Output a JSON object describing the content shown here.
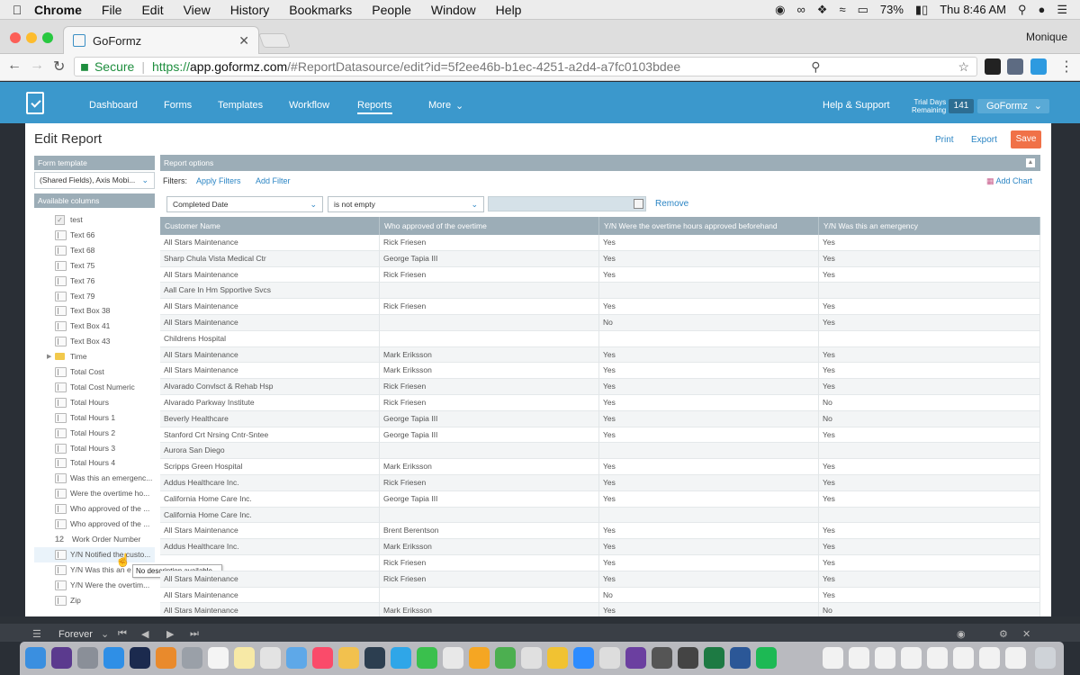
{
  "menubar": {
    "items": [
      "Chrome",
      "File",
      "Edit",
      "View",
      "History",
      "Bookmarks",
      "People",
      "Window",
      "Help"
    ],
    "battery": "73%",
    "clock": "Thu 8:46 AM"
  },
  "browser": {
    "tab_title": "GoFormz",
    "profile": "Monique",
    "secure_label": "Secure",
    "url_proto": "https://",
    "url_host": "app.goformz.com",
    "url_path": "/#ReportDatasource/edit?id=5f2ee46b-b1ec-4251-a2d4-a7fc0103bdee"
  },
  "app": {
    "nav": [
      "Dashboard",
      "Forms",
      "Templates",
      "Workflow",
      "Reports",
      "More"
    ],
    "help": "Help & Support",
    "trial_l1": "Trial Days",
    "trial_l2": "Remaining",
    "trial_count": "141",
    "account": "GoFormz"
  },
  "page": {
    "title": "Edit Report",
    "print": "Print",
    "export": "Export",
    "save": "Save"
  },
  "left": {
    "form_template_label": "Form template",
    "form_template_value": "(Shared Fields), Axis Mobi...",
    "available_columns_label": "Available columns",
    "columns": [
      {
        "label": "test",
        "icon": "check"
      },
      {
        "label": "Text 66",
        "icon": "text"
      },
      {
        "label": "Text 68",
        "icon": "text"
      },
      {
        "label": "Text 75",
        "icon": "text"
      },
      {
        "label": "Text 76",
        "icon": "text"
      },
      {
        "label": "Text 79",
        "icon": "text"
      },
      {
        "label": "Text Box 38",
        "icon": "text"
      },
      {
        "label": "Text Box 41",
        "icon": "text"
      },
      {
        "label": "Text Box 43",
        "icon": "text"
      },
      {
        "label": "Time",
        "icon": "folder"
      },
      {
        "label": "Total Cost",
        "icon": "text"
      },
      {
        "label": "Total Cost Numeric",
        "icon": "text"
      },
      {
        "label": "Total Hours",
        "icon": "text"
      },
      {
        "label": "Total Hours 1",
        "icon": "text"
      },
      {
        "label": "Total Hours 2",
        "icon": "text"
      },
      {
        "label": "Total Hours 3",
        "icon": "text"
      },
      {
        "label": "Total Hours 4",
        "icon": "text"
      },
      {
        "label": "Was this an emergenc...",
        "icon": "text"
      },
      {
        "label": "Were the overtime ho...",
        "icon": "text"
      },
      {
        "label": "Who approved of the ...",
        "icon": "text"
      },
      {
        "label": "Who approved of the ...",
        "icon": "text"
      },
      {
        "label": "Work Order Number",
        "icon": "number"
      },
      {
        "label": "Y/N Notified the custo...",
        "icon": "text"
      },
      {
        "label": "Y/N Was this an e",
        "icon": "text"
      },
      {
        "label": "Y/N Were the overtim...",
        "icon": "text"
      },
      {
        "label": "Zip",
        "icon": "text"
      }
    ],
    "tooltip": "No description available.",
    "number_glyph": "12"
  },
  "report": {
    "options_label": "Report options",
    "filters_label": "Filters:",
    "apply_filters": "Apply Filters",
    "add_filter": "Add Filter",
    "add_chart": "Add Chart",
    "filter_field": "Completed Date",
    "filter_op": "is not empty",
    "remove": "Remove",
    "columns": [
      "Customer Name",
      "Who approved of the overtime",
      "Y/N Were the overtime hours approved beforehand",
      "Y/N Was this an emergency"
    ],
    "rows": [
      [
        "All Stars Maintenance",
        "Rick Friesen",
        "Yes",
        "Yes"
      ],
      [
        "Sharp Chula Vista Medical Ctr",
        "George Tapia III",
        "Yes",
        "Yes"
      ],
      [
        "All Stars Maintenance",
        "Rick Friesen",
        "Yes",
        "Yes"
      ],
      [
        "Aall Care In Hm Spportive Svcs",
        "",
        "",
        ""
      ],
      [
        "All Stars Maintenance",
        "Rick Friesen",
        "Yes",
        "Yes"
      ],
      [
        "All Stars Maintenance",
        "",
        "No",
        "Yes"
      ],
      [
        "Childrens Hospital",
        "",
        "",
        ""
      ],
      [
        "All Stars Maintenance",
        "Mark Eriksson",
        "Yes",
        "Yes"
      ],
      [
        "All Stars Maintenance",
        "Mark Eriksson",
        "Yes",
        "Yes"
      ],
      [
        "Alvarado Convlsct & Rehab Hsp",
        "Rick Friesen",
        "Yes",
        "Yes"
      ],
      [
        "Alvarado Parkway Institute",
        "Rick Friesen",
        "Yes",
        "No"
      ],
      [
        "Beverly Healthcare",
        "George Tapia III",
        "Yes",
        "No"
      ],
      [
        "Stanford Crt Nrsing Cntr-Sntee",
        "George Tapia III",
        "Yes",
        "Yes"
      ],
      [
        "Aurora San Diego",
        "",
        "",
        ""
      ],
      [
        "Scripps Green Hospital",
        "Mark Eriksson",
        "Yes",
        "Yes"
      ],
      [
        "Addus Healthcare Inc.",
        "Rick Friesen",
        "Yes",
        "Yes"
      ],
      [
        "California Home Care Inc.",
        "George Tapia III",
        "Yes",
        "Yes"
      ],
      [
        "California Home Care Inc.",
        "",
        "",
        ""
      ],
      [
        "All Stars Maintenance",
        "Brent Berentson",
        "Yes",
        "Yes"
      ],
      [
        "Addus Healthcare Inc.",
        "Mark Eriksson",
        "Yes",
        "Yes"
      ],
      [
        "",
        "Rick Friesen",
        "Yes",
        "Yes"
      ],
      [
        "All Stars Maintenance",
        "Rick Friesen",
        "Yes",
        "Yes"
      ],
      [
        "All Stars Maintenance",
        "",
        "No",
        "Yes"
      ],
      [
        "All Stars Maintenance",
        "Mark Eriksson",
        "Yes",
        "No"
      ]
    ]
  },
  "player": {
    "loop": "Forever"
  },
  "colors": {
    "header_blue": "#3b98cc",
    "save_orange": "#f07148",
    "panel_gray": "#9cadb7",
    "link_blue": "#2b85c4"
  }
}
